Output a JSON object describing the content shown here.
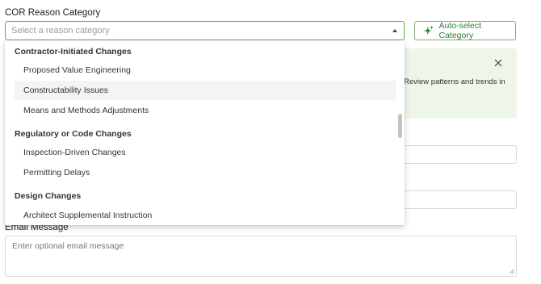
{
  "reason": {
    "label": "COR Reason Category",
    "placeholder": "Select a reason category"
  },
  "auto_select": {
    "label": "Auto-select Category",
    "icon": "sparkle-icon"
  },
  "info_panel": {
    "text": "Review patterns and trends in",
    "close_icon": "close-icon"
  },
  "dropdown": {
    "items": [
      {
        "type": "group",
        "label": "Contractor-Initiated Changes"
      },
      {
        "type": "option",
        "label": "Proposed Value Engineering"
      },
      {
        "type": "option",
        "label": "Constructability Issues",
        "highlighted": true
      },
      {
        "type": "option",
        "label": "Means and Methods Adjustments"
      },
      {
        "type": "group",
        "label": "Regulatory or Code Changes"
      },
      {
        "type": "option",
        "label": "Inspection-Driven Changes"
      },
      {
        "type": "option",
        "label": "Permitting Delays"
      },
      {
        "type": "group",
        "label": "Design Changes"
      },
      {
        "type": "option",
        "label": "Architect Supplemental Instruction"
      }
    ]
  },
  "email": {
    "label": "Email Message",
    "placeholder": "Enter optional email message"
  },
  "colors": {
    "accent": "#6aa84f",
    "accent_text": "#2e7d32",
    "info_bg": "#eef6ea"
  }
}
